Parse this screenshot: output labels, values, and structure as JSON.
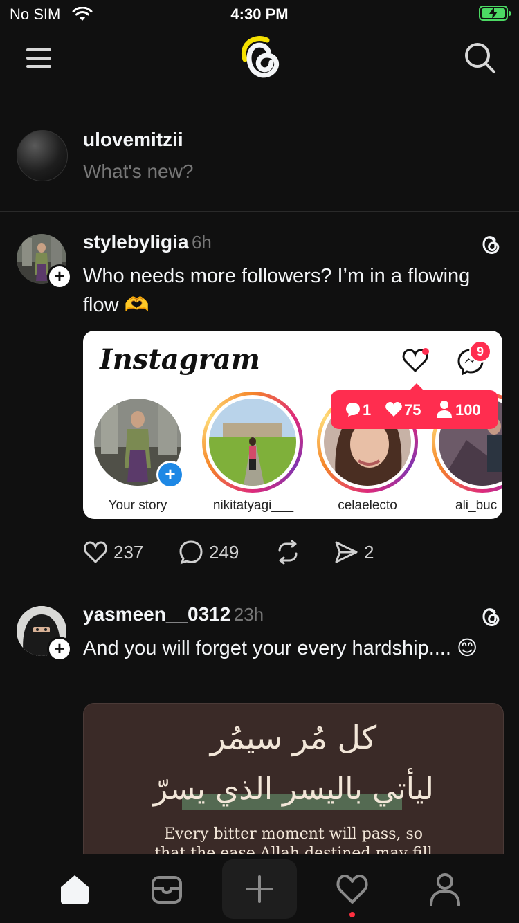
{
  "status_bar": {
    "carrier": "No SIM",
    "time": "4:30 PM"
  },
  "composer": {
    "username": "ulovemitzii",
    "placeholder": "What's new?"
  },
  "posts": [
    {
      "username": "stylebyligia",
      "time_ago": "6h",
      "text": "Who needs more followers? I’m in a flowing flow 🫶",
      "image": {
        "app_name": "Instagram",
        "dm_badge": "9",
        "notification": {
          "comments": "1",
          "likes": "75",
          "followers": "100"
        },
        "stories": [
          {
            "label": "Your story"
          },
          {
            "label": "nikitatyagi___"
          },
          {
            "label": "celaelecto"
          },
          {
            "label": "ali_buc"
          }
        ]
      },
      "likes": "237",
      "comments": "249",
      "shares": "2"
    },
    {
      "username": "yasmeen__0312",
      "time_ago": "23h",
      "text": "And you will forget your every hardship.... 😊",
      "image": {
        "arabic_line1": "كل مُر سيمُر",
        "arabic_line2": "ليأتي باليسر الذي يسرّ",
        "english_line1": "Every bitter moment will pass, so",
        "english_line2": "that the ease Allah destined may fill"
      }
    }
  ],
  "colors": {
    "background": "#101010",
    "accent_red": "#ff2d4f",
    "battery_green": "#4cd964"
  }
}
